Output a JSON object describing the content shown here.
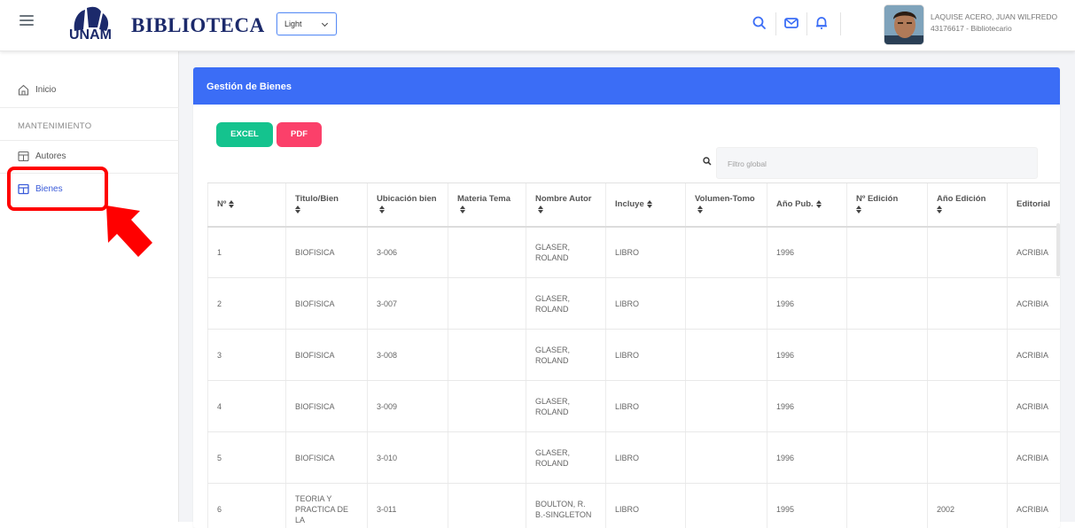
{
  "header": {
    "logo_text": "UNAM",
    "app_title": "BIBLIOTECA",
    "theme_selected": "Light",
    "user_name": "LAQUISE ACERO, JUAN WILFREDO",
    "user_role": "43176617 - Bibliotecario"
  },
  "sidebar": {
    "items": [
      {
        "label": "Inicio"
      },
      {
        "label": "Autores"
      },
      {
        "label": "Bienes"
      }
    ],
    "section_header": "MANTENIMIENTO",
    "annotation_color": "#ff0000"
  },
  "card": {
    "title": "Gestión de Bienes",
    "buttons": {
      "excel": "EXCEL",
      "pdf": "PDF"
    },
    "search_placeholder": "Filtro global"
  },
  "table": {
    "columns": [
      "Nº",
      "Titulo/Bien",
      "Ubicación bien",
      "Materia Tema",
      "Nombre Autor",
      "Incluye",
      "Volumen-Tomo",
      "Año Pub.",
      "Nº Edición",
      "Año Edición",
      "Editorial"
    ],
    "rows": [
      {
        "n": "1",
        "titulo": "BIOFISICA",
        "ubicacion": "3-006",
        "materia": "",
        "autor": "GLASER, ROLAND",
        "incluye": "LIBRO",
        "volumen": "",
        "anio_pub": "1996",
        "n_edicion": "",
        "anio_edicion": "",
        "editorial": "ACRIBIA"
      },
      {
        "n": "2",
        "titulo": "BIOFISICA",
        "ubicacion": "3-007",
        "materia": "",
        "autor": "GLASER, ROLAND",
        "incluye": "LIBRO",
        "volumen": "",
        "anio_pub": "1996",
        "n_edicion": "",
        "anio_edicion": "",
        "editorial": "ACRIBIA"
      },
      {
        "n": "3",
        "titulo": "BIOFISICA",
        "ubicacion": "3-008",
        "materia": "",
        "autor": "GLASER, ROLAND",
        "incluye": "LIBRO",
        "volumen": "",
        "anio_pub": "1996",
        "n_edicion": "",
        "anio_edicion": "",
        "editorial": "ACRIBIA"
      },
      {
        "n": "4",
        "titulo": "BIOFISICA",
        "ubicacion": "3-009",
        "materia": "",
        "autor": "GLASER, ROLAND",
        "incluye": "LIBRO",
        "volumen": "",
        "anio_pub": "1996",
        "n_edicion": "",
        "anio_edicion": "",
        "editorial": "ACRIBIA"
      },
      {
        "n": "5",
        "titulo": "BIOFISICA",
        "ubicacion": "3-010",
        "materia": "",
        "autor": "GLASER, ROLAND",
        "incluye": "LIBRO",
        "volumen": "",
        "anio_pub": "1996",
        "n_edicion": "",
        "anio_edicion": "",
        "editorial": "ACRIBIA"
      },
      {
        "n": "6",
        "titulo": "TEORIA Y PRACTICA DE LA",
        "ubicacion": "3-011",
        "materia": "",
        "autor": "BOULTON, R. B.-SINGLETON",
        "incluye": "LIBRO",
        "volumen": "",
        "anio_pub": "1995",
        "n_edicion": "",
        "anio_edicion": "2002",
        "editorial": "ACRIBIA"
      }
    ]
  },
  "colors": {
    "primary": "#3b6df6",
    "excel": "#14c38e",
    "pdf": "#fb406a",
    "brand_text": "#1c2a6b"
  }
}
